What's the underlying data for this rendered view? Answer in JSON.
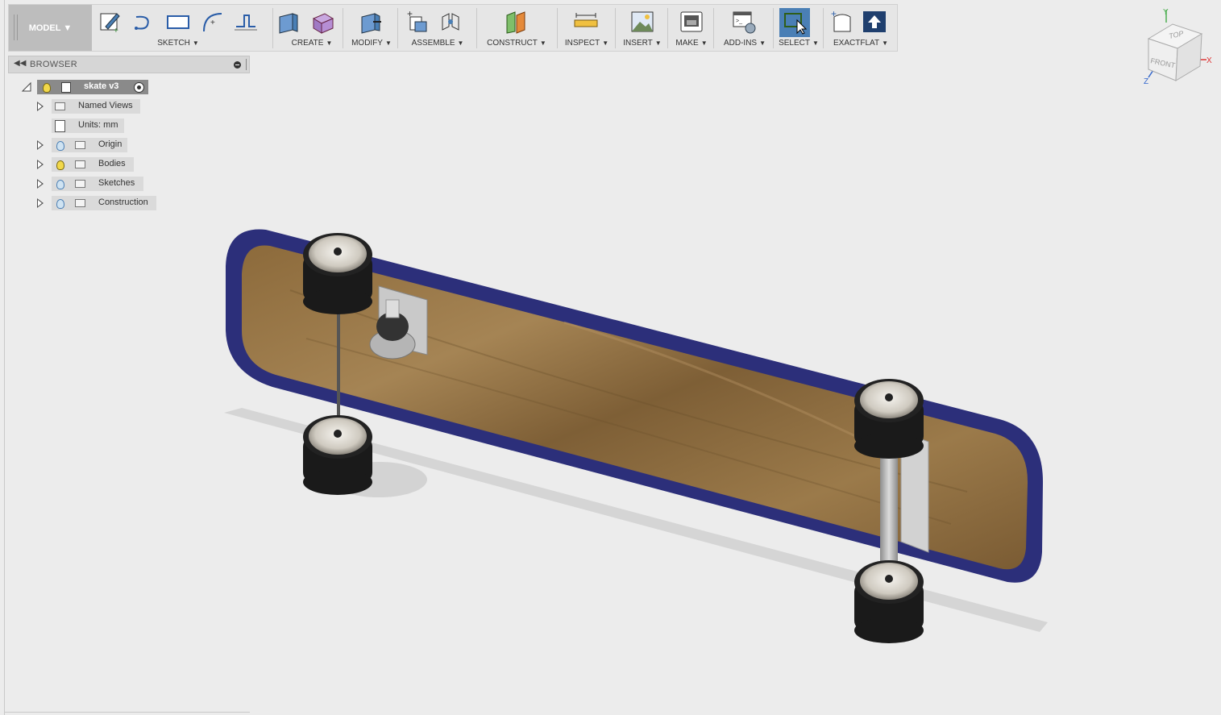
{
  "workspace": {
    "label": "MODEL"
  },
  "toolbar": {
    "sketch": "SKETCH",
    "create": "CREATE",
    "modify": "MODIFY",
    "assemble": "ASSEMBLE",
    "construct": "CONSTRUCT",
    "inspect": "INSPECT",
    "insert": "INSERT",
    "make": "MAKE",
    "addins": "ADD-INS",
    "select": "SELECT",
    "exactflat": "EXACTFLAT"
  },
  "browser": {
    "title": "BROWSER",
    "root": "skate v3",
    "items": [
      {
        "label": "Named Views"
      },
      {
        "label": "Units: mm"
      },
      {
        "label": "Origin"
      },
      {
        "label": "Bodies"
      },
      {
        "label": "Sketches"
      },
      {
        "label": "Construction"
      }
    ]
  },
  "viewcube": {
    "top": "TOP",
    "front": "FRONT",
    "axis_x": "X",
    "axis_y": "Y",
    "axis_z": "Z"
  },
  "colors": {
    "accent": "#4a7fb5",
    "deck_trim": "#2c2f7a",
    "wood": "#8a6a3e",
    "wheel": "#1a1a1a"
  }
}
